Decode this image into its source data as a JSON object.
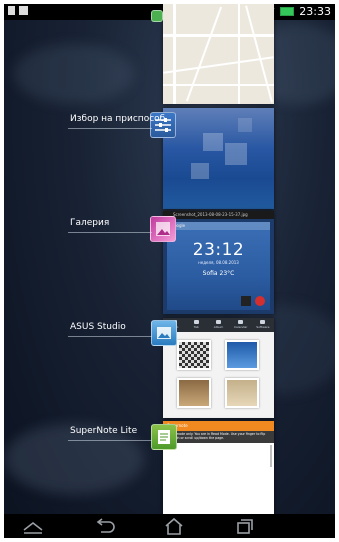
{
  "status_bar": {
    "time": "23:33",
    "left_icons": [
      "document-icon",
      "download-icon"
    ],
    "right_icons": [
      "mute-icon",
      "wifi-icon",
      "battery-icon"
    ]
  },
  "recent_tasks": [
    {
      "label": "",
      "icon": "maps-icon",
      "thumbnail": "maps"
    },
    {
      "label": "Избор на приспособ",
      "icon": "settings-sliders-icon",
      "thumbnail": "wallpaper"
    },
    {
      "label": "Галерия",
      "icon": "gallery-icon",
      "thumbnail": "gallery"
    },
    {
      "label": "ASUS Studio",
      "icon": "asus-studio-icon",
      "thumbnail": "asus-studio"
    },
    {
      "label": "SuperNote Lite",
      "icon": "supernote-icon",
      "thumbnail": "supernote"
    }
  ],
  "thumbnails": {
    "gallery": {
      "top_text": "Screenshot_2013-08-08-23-15-37.jpg",
      "bar_text": "Google",
      "time": "23:12",
      "date": "неделя, 08.08.2013",
      "weather": "Sofia 23°C"
    },
    "studio": {
      "tabs": [
        "Photo",
        "Tab",
        "Album",
        "Calendar",
        "Software"
      ]
    },
    "supernote": {
      "app_name": "Supernote",
      "message": "Read mode only. You are in Read Mode. Use your finger to flip through or scroll up/down the page."
    }
  },
  "nav_bar": {
    "buttons": [
      "up-arrow-icon",
      "back-icon",
      "home-icon",
      "recent-apps-icon"
    ]
  }
}
